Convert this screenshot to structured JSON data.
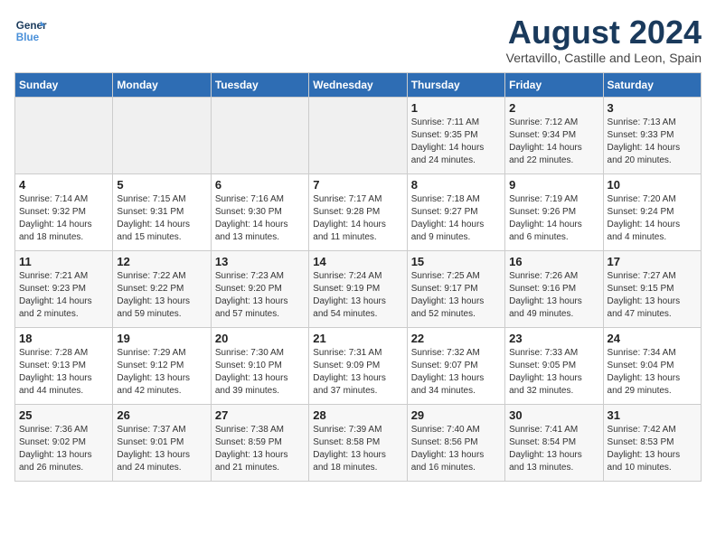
{
  "header": {
    "logo_line1": "General",
    "logo_line2": "Blue",
    "month_year": "August 2024",
    "location": "Vertavillo, Castille and Leon, Spain"
  },
  "weekdays": [
    "Sunday",
    "Monday",
    "Tuesday",
    "Wednesday",
    "Thursday",
    "Friday",
    "Saturday"
  ],
  "weeks": [
    [
      {
        "day": "",
        "info": ""
      },
      {
        "day": "",
        "info": ""
      },
      {
        "day": "",
        "info": ""
      },
      {
        "day": "",
        "info": ""
      },
      {
        "day": "1",
        "info": "Sunrise: 7:11 AM\nSunset: 9:35 PM\nDaylight: 14 hours\nand 24 minutes."
      },
      {
        "day": "2",
        "info": "Sunrise: 7:12 AM\nSunset: 9:34 PM\nDaylight: 14 hours\nand 22 minutes."
      },
      {
        "day": "3",
        "info": "Sunrise: 7:13 AM\nSunset: 9:33 PM\nDaylight: 14 hours\nand 20 minutes."
      }
    ],
    [
      {
        "day": "4",
        "info": "Sunrise: 7:14 AM\nSunset: 9:32 PM\nDaylight: 14 hours\nand 18 minutes."
      },
      {
        "day": "5",
        "info": "Sunrise: 7:15 AM\nSunset: 9:31 PM\nDaylight: 14 hours\nand 15 minutes."
      },
      {
        "day": "6",
        "info": "Sunrise: 7:16 AM\nSunset: 9:30 PM\nDaylight: 14 hours\nand 13 minutes."
      },
      {
        "day": "7",
        "info": "Sunrise: 7:17 AM\nSunset: 9:28 PM\nDaylight: 14 hours\nand 11 minutes."
      },
      {
        "day": "8",
        "info": "Sunrise: 7:18 AM\nSunset: 9:27 PM\nDaylight: 14 hours\nand 9 minutes."
      },
      {
        "day": "9",
        "info": "Sunrise: 7:19 AM\nSunset: 9:26 PM\nDaylight: 14 hours\nand 6 minutes."
      },
      {
        "day": "10",
        "info": "Sunrise: 7:20 AM\nSunset: 9:24 PM\nDaylight: 14 hours\nand 4 minutes."
      }
    ],
    [
      {
        "day": "11",
        "info": "Sunrise: 7:21 AM\nSunset: 9:23 PM\nDaylight: 14 hours\nand 2 minutes."
      },
      {
        "day": "12",
        "info": "Sunrise: 7:22 AM\nSunset: 9:22 PM\nDaylight: 13 hours\nand 59 minutes."
      },
      {
        "day": "13",
        "info": "Sunrise: 7:23 AM\nSunset: 9:20 PM\nDaylight: 13 hours\nand 57 minutes."
      },
      {
        "day": "14",
        "info": "Sunrise: 7:24 AM\nSunset: 9:19 PM\nDaylight: 13 hours\nand 54 minutes."
      },
      {
        "day": "15",
        "info": "Sunrise: 7:25 AM\nSunset: 9:17 PM\nDaylight: 13 hours\nand 52 minutes."
      },
      {
        "day": "16",
        "info": "Sunrise: 7:26 AM\nSunset: 9:16 PM\nDaylight: 13 hours\nand 49 minutes."
      },
      {
        "day": "17",
        "info": "Sunrise: 7:27 AM\nSunset: 9:15 PM\nDaylight: 13 hours\nand 47 minutes."
      }
    ],
    [
      {
        "day": "18",
        "info": "Sunrise: 7:28 AM\nSunset: 9:13 PM\nDaylight: 13 hours\nand 44 minutes."
      },
      {
        "day": "19",
        "info": "Sunrise: 7:29 AM\nSunset: 9:12 PM\nDaylight: 13 hours\nand 42 minutes."
      },
      {
        "day": "20",
        "info": "Sunrise: 7:30 AM\nSunset: 9:10 PM\nDaylight: 13 hours\nand 39 minutes."
      },
      {
        "day": "21",
        "info": "Sunrise: 7:31 AM\nSunset: 9:09 PM\nDaylight: 13 hours\nand 37 minutes."
      },
      {
        "day": "22",
        "info": "Sunrise: 7:32 AM\nSunset: 9:07 PM\nDaylight: 13 hours\nand 34 minutes."
      },
      {
        "day": "23",
        "info": "Sunrise: 7:33 AM\nSunset: 9:05 PM\nDaylight: 13 hours\nand 32 minutes."
      },
      {
        "day": "24",
        "info": "Sunrise: 7:34 AM\nSunset: 9:04 PM\nDaylight: 13 hours\nand 29 minutes."
      }
    ],
    [
      {
        "day": "25",
        "info": "Sunrise: 7:36 AM\nSunset: 9:02 PM\nDaylight: 13 hours\nand 26 minutes."
      },
      {
        "day": "26",
        "info": "Sunrise: 7:37 AM\nSunset: 9:01 PM\nDaylight: 13 hours\nand 24 minutes."
      },
      {
        "day": "27",
        "info": "Sunrise: 7:38 AM\nSunset: 8:59 PM\nDaylight: 13 hours\nand 21 minutes."
      },
      {
        "day": "28",
        "info": "Sunrise: 7:39 AM\nSunset: 8:58 PM\nDaylight: 13 hours\nand 18 minutes."
      },
      {
        "day": "29",
        "info": "Sunrise: 7:40 AM\nSunset: 8:56 PM\nDaylight: 13 hours\nand 16 minutes."
      },
      {
        "day": "30",
        "info": "Sunrise: 7:41 AM\nSunset: 8:54 PM\nDaylight: 13 hours\nand 13 minutes."
      },
      {
        "day": "31",
        "info": "Sunrise: 7:42 AM\nSunset: 8:53 PM\nDaylight: 13 hours\nand 10 minutes."
      }
    ]
  ]
}
